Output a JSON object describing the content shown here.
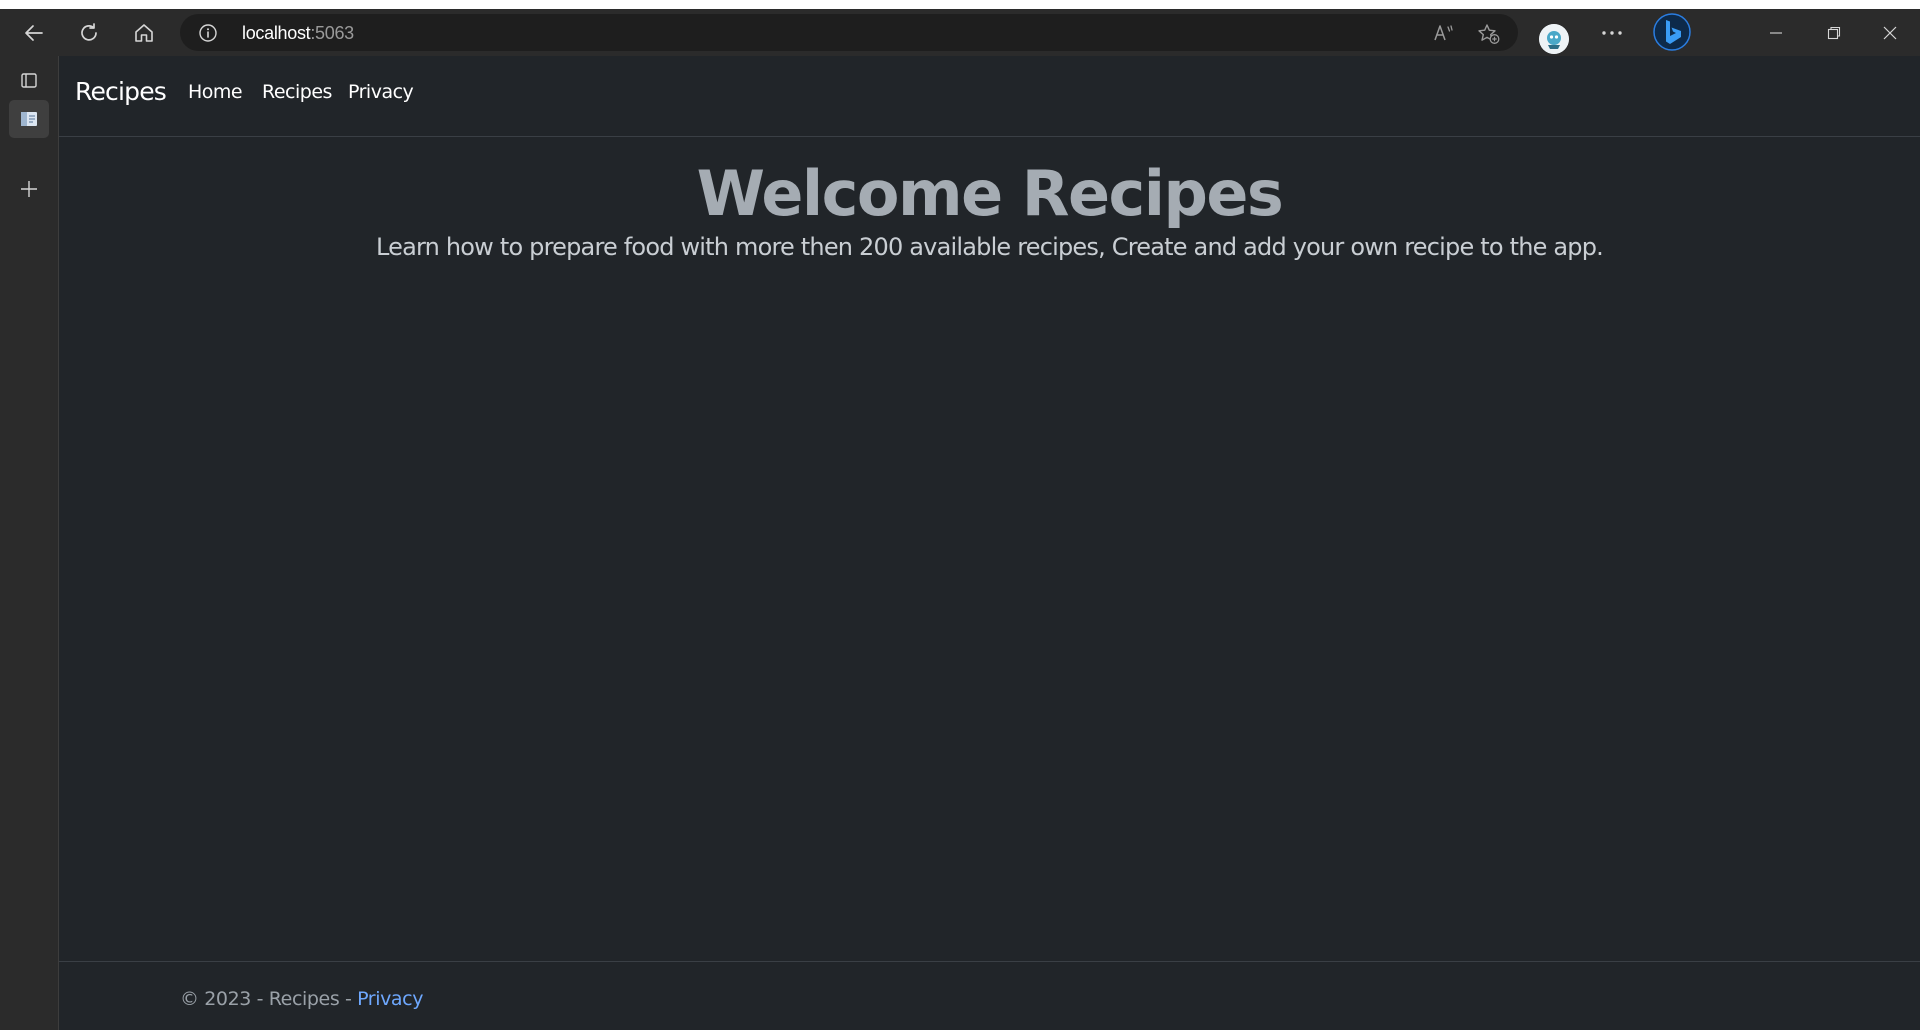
{
  "browser": {
    "url_host": "localhost",
    "url_port": ":5063",
    "toolbar_icons": [
      "back-icon",
      "refresh-icon",
      "home-icon",
      "site-info-icon",
      "read-aloud-icon",
      "add-favorite-icon",
      "profile-avatar",
      "more-options-icon",
      "copilot-icon"
    ],
    "window_controls": [
      "minimize-icon",
      "restore-icon",
      "close-icon"
    ],
    "sidebar_icons": [
      "tab-actions-icon",
      "vertical-tab-icon",
      "new-tab-icon"
    ]
  },
  "navbar": {
    "brand": "Recipes",
    "links": [
      "Home",
      "Recipes",
      "Privacy"
    ]
  },
  "hero": {
    "title": "Welcome Recipes",
    "subtitle": "Learn how to prepare food with more then 200 available recipes, Create and add your own recipe to the app."
  },
  "footer": {
    "text": "© 2023 - Recipes - ",
    "link": "Privacy"
  },
  "colors": {
    "page_bg": "#212529",
    "browser_chrome": "#2b2b2b",
    "hero_title": "#a5acb3",
    "link": "#6ea8fe"
  }
}
